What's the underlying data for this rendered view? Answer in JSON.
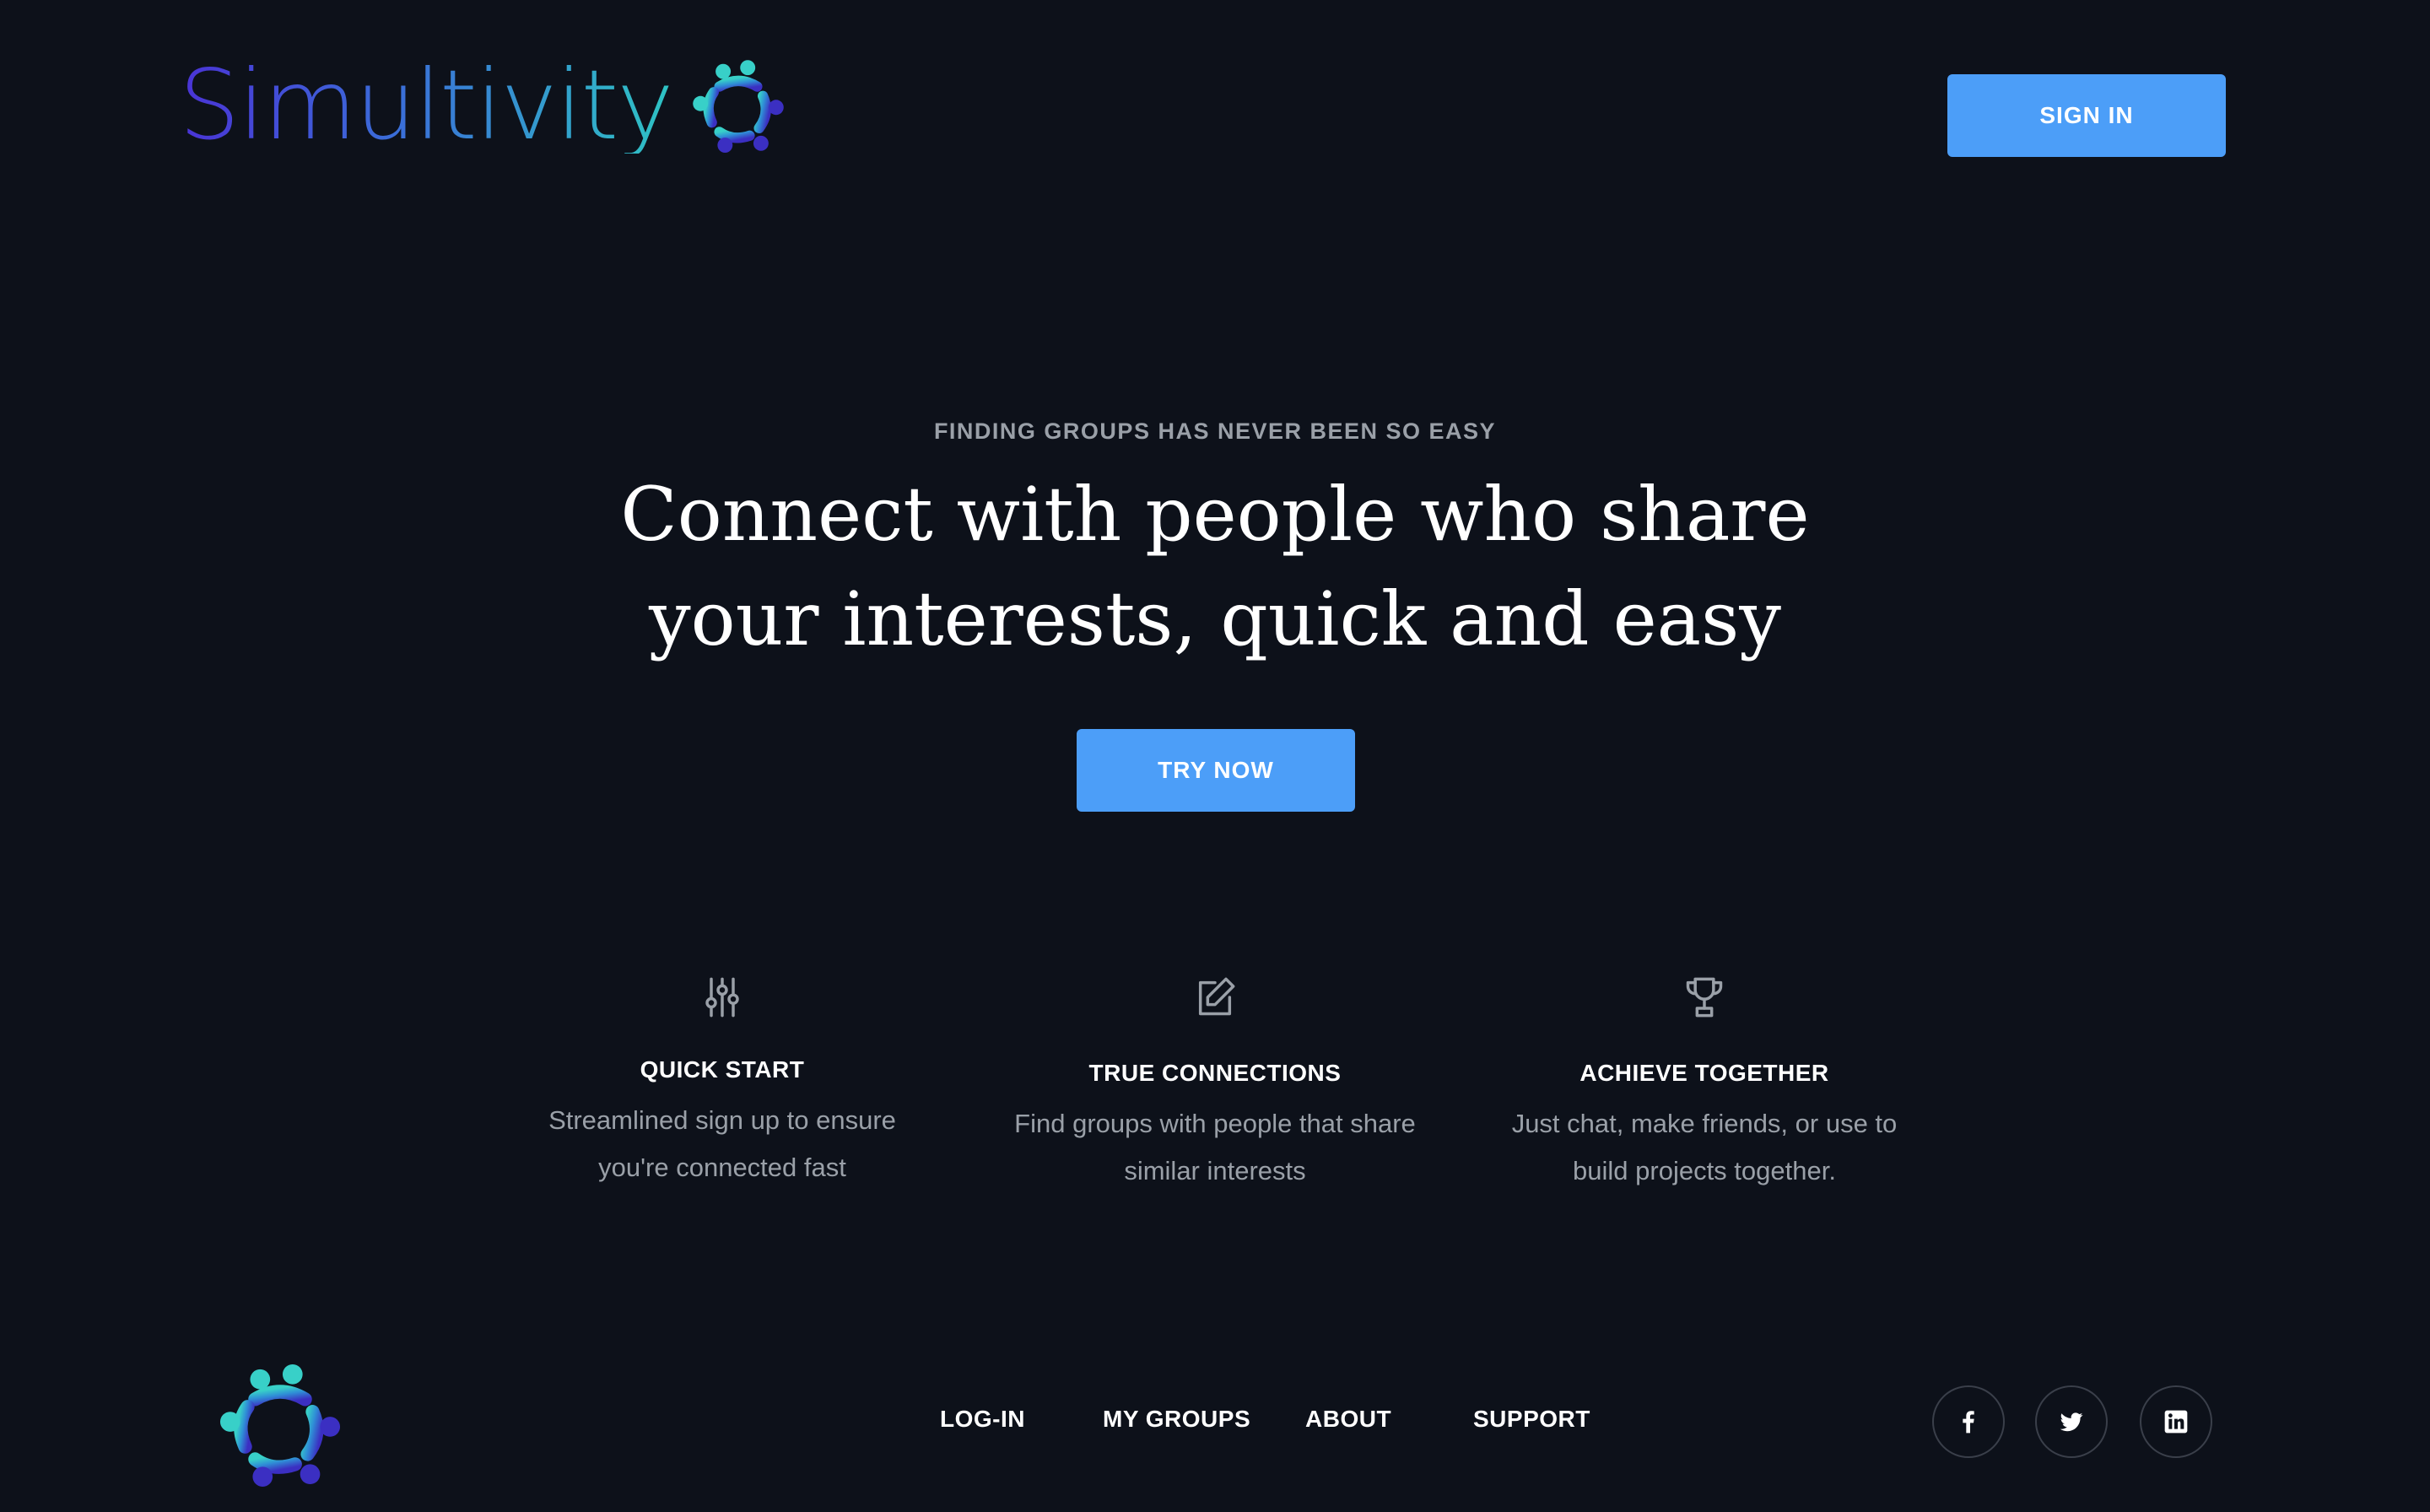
{
  "header": {
    "brand_name": "Simultivity",
    "signin_label": "SIGN IN"
  },
  "hero": {
    "eyebrow": "FINDING GROUPS HAS NEVER BEEN SO EASY",
    "title_line1": "Connect with people who share",
    "title_line2": "your interests, quick and easy",
    "cta_label": "TRY NOW"
  },
  "features": [
    {
      "icon": "sliders-icon",
      "title": "QUICK START",
      "desc_line1": "Streamlined sign up to ensure",
      "desc_line2": "you're connected fast"
    },
    {
      "icon": "edit-icon",
      "title": "TRUE CONNECTIONS",
      "desc_line1": "Find groups with people that share",
      "desc_line2": "similar interests"
    },
    {
      "icon": "trophy-icon",
      "title": "ACHIEVE TOGETHER",
      "desc_line1": "Just chat, make friends, or use to",
      "desc_line2": "build projects together."
    }
  ],
  "footer": {
    "nav": [
      "LOG-IN",
      "MY GROUPS",
      "ABOUT",
      "SUPPORT"
    ],
    "social": [
      "facebook-icon",
      "twitter-icon",
      "linkedin-icon"
    ]
  },
  "colors": {
    "background": "#0d111a",
    "accent": "#4c9ef8",
    "muted_text": "#9aa0a8",
    "logo_gradient_start": "#4a33d6",
    "logo_gradient_end": "#2ec4c4"
  }
}
